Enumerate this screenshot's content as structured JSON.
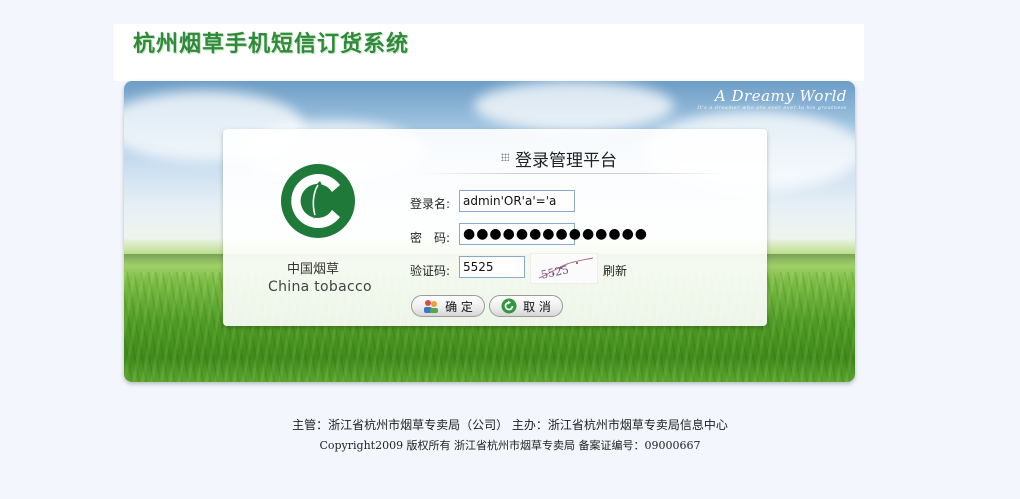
{
  "header": {
    "title": "杭州烟草手机短信订货系统"
  },
  "banner": {
    "brand_title": "A Dreamy World",
    "brand_subtitle": "It's a dreamer who are ever ever to his greatness"
  },
  "logo": {
    "name_cn": "中国烟草",
    "name_en": "China tobacco"
  },
  "login": {
    "title": "登录管理平台",
    "username_label": "登录名:",
    "username_value": "admin'OR'a'='a",
    "password_label": "密　码:",
    "password_value": "●●●●●●●●●●●●●●",
    "captcha_label": "验证码:",
    "captcha_value": "5525",
    "captcha_image_text": "5525",
    "refresh_label": "刷新",
    "confirm_label": "确 定",
    "cancel_label": "取 消"
  },
  "footer": {
    "line1": "主管：浙江省杭州市烟草专卖局（公司）  主办：浙江省杭州市烟草专卖局信息中心",
    "line2": "Copyright2009 版权所有  浙江省杭州市烟草专卖局  备案证编号：09000667"
  },
  "colors": {
    "brand_green": "#2f8a3a",
    "logo_green": "#1f7a3a",
    "page_bg": "#f3f7fd"
  },
  "icons": {
    "confirm": "users-icon",
    "cancel": "refresh-arrow-icon"
  }
}
